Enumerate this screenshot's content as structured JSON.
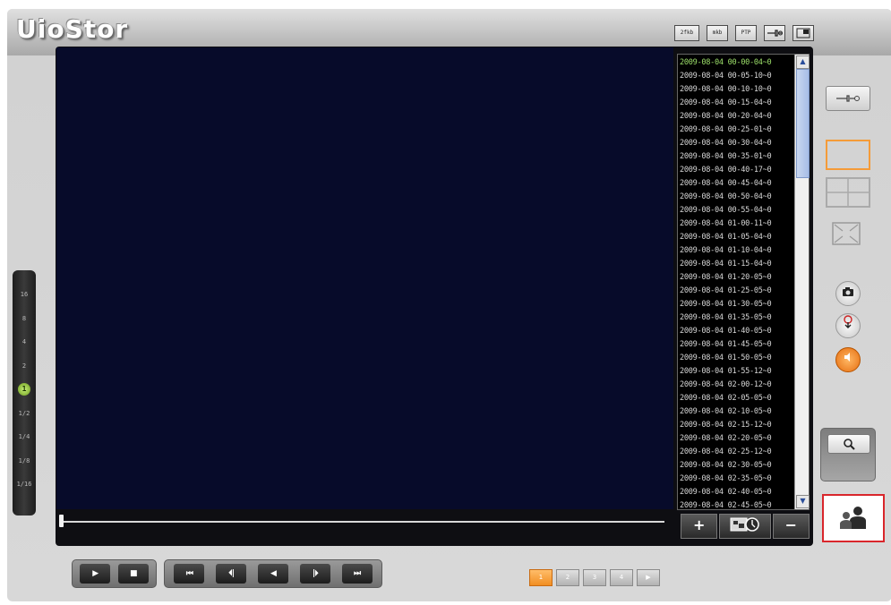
{
  "app": {
    "title": "UioStor"
  },
  "top_icons": [
    {
      "label": "2fkb",
      "icon": "2fkb-icon"
    },
    {
      "label": "mkb",
      "icon": "mkb-icon"
    },
    {
      "label": "PTP",
      "icon": "ptp-icon"
    },
    {
      "label": "",
      "icon": "tools-icon"
    },
    {
      "label": "",
      "icon": "fullscreen-icon"
    }
  ],
  "speed": {
    "items": [
      "16",
      "8",
      "4",
      "2",
      "1",
      "1/2",
      "1/4",
      "1/8",
      "1/16"
    ],
    "active_index": 4
  },
  "recordings": {
    "selected_index": 0,
    "items": [
      "2009-08-04 00-00-04~0",
      "2009-08-04 00-05-10~0",
      "2009-08-04 00-10-10~0",
      "2009-08-04 00-15-04~0",
      "2009-08-04 00-20-04~0",
      "2009-08-04 00-25-01~0",
      "2009-08-04 00-30-04~0",
      "2009-08-04 00-35-01~0",
      "2009-08-04 00-40-17~0",
      "2009-08-04 00-45-04~0",
      "2009-08-04 00-50-04~0",
      "2009-08-04 00-55-04~0",
      "2009-08-04 01-00-11~0",
      "2009-08-04 01-05-04~0",
      "2009-08-04 01-10-04~0",
      "2009-08-04 01-15-04~0",
      "2009-08-04 01-20-05~0",
      "2009-08-04 01-25-05~0",
      "2009-08-04 01-30-05~0",
      "2009-08-04 01-35-05~0",
      "2009-08-04 01-40-05~0",
      "2009-08-04 01-45-05~0",
      "2009-08-04 01-50-05~0",
      "2009-08-04 01-55-12~0",
      "2009-08-04 02-00-12~0",
      "2009-08-04 02-05-05~0",
      "2009-08-04 02-10-05~0",
      "2009-08-04 02-15-12~0",
      "2009-08-04 02-20-05~0",
      "2009-08-04 02-25-12~0",
      "2009-08-04 02-30-05~0",
      "2009-08-04 02-35-05~0",
      "2009-08-04 02-40-05~0",
      "2009-08-04 02-45-05~0"
    ]
  },
  "list_controls": {
    "plus": "+",
    "minus": "−",
    "mid_icon": "zoom-time-icon"
  },
  "playback": {
    "group1": [
      "▶",
      "■"
    ],
    "group2": [
      "⏮",
      "⏴|",
      "◀",
      "|⏵",
      "⏭"
    ]
  },
  "pages": {
    "items": [
      "1",
      "2",
      "3",
      "4",
      "▶"
    ],
    "active_index": 0
  },
  "colors": {
    "accent": "#f59b38",
    "video_bg": "#070b2a",
    "selected_text": "#9de06a",
    "highlight_border": "#d9262b"
  }
}
